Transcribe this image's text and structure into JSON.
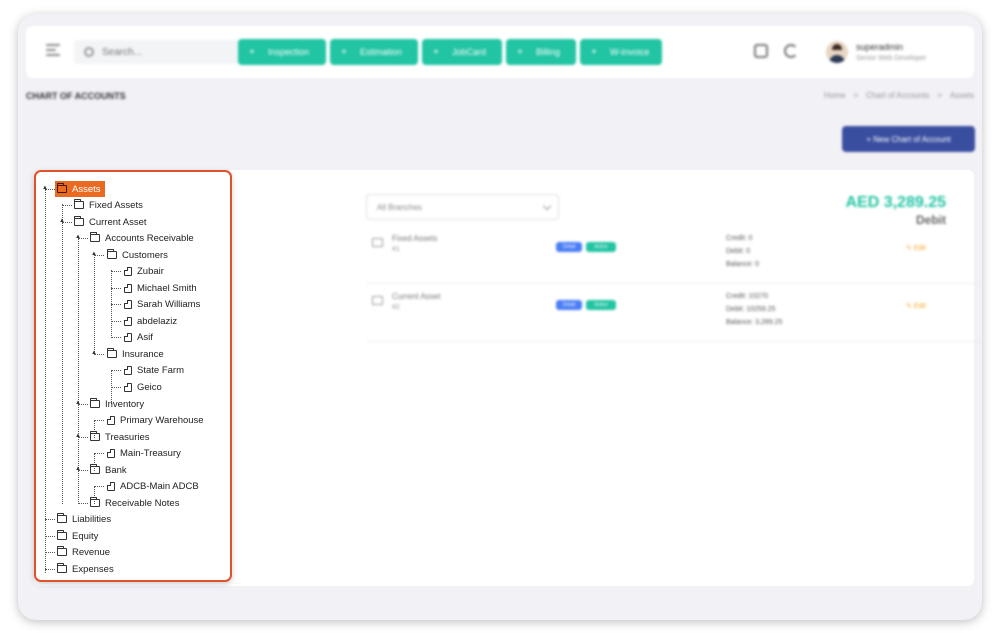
{
  "topbar": {
    "search_placeholder": "Search...",
    "quick_actions": [
      {
        "label": "Inspection"
      },
      {
        "label": "Estimation"
      },
      {
        "label": "JobCard"
      },
      {
        "label": "Billing"
      },
      {
        "label": "W-invoice"
      }
    ],
    "user": {
      "name": "superadmin",
      "role": "Senior Web Developer"
    }
  },
  "page": {
    "title": "CHART OF ACCOUNTS",
    "breadcrumbs": [
      "Home",
      ">",
      "Chart of Accounts",
      ">",
      "Assets"
    ],
    "new_button": "+ New Chart of Account"
  },
  "tree": {
    "assets": "Assets",
    "fixed_assets": "Fixed Assets",
    "current_asset": "Current Asset",
    "accounts_receivable": "Accounts Receivable",
    "customers": "Customers",
    "zubair": "Zubair",
    "michael": "Michael Smith",
    "sarah": "Sarah Williams",
    "abdelaziz": "abdelaziz",
    "asif": "Asif",
    "insurance": "Insurance",
    "state_farm": "State Farm",
    "geico": "Geico",
    "inventory": "Inventory",
    "primary_warehouse": "Primary Warehouse",
    "treasuries": "Treasuries",
    "main_treasury": "Main-Treasury",
    "bank": "Bank",
    "adcb": "ADCB-Main ADCB",
    "receivable_notes": "Receivable Notes",
    "liabilities": "Liabilities",
    "equity": "Equity",
    "revenue": "Revenue",
    "expenses": "Expenses"
  },
  "detail": {
    "branch_select": "All Branches",
    "amount": "AED 3,289.25",
    "amount_type": "Debit",
    "rows": [
      {
        "name": "Fixed Assets",
        "code": "#1",
        "badge1": "Detail",
        "badge2": "Active",
        "credit": "Credit: 0",
        "debit": "Debit: 0",
        "balance": "Balance: 0",
        "edit": "✎ Edit"
      },
      {
        "name": "Current Asset",
        "code": "#2",
        "badge1": "Detail",
        "badge2": "Active",
        "credit": "Credit: 10270",
        "debit": "Debit: 10259.25",
        "balance": "Balance: 3,289.25",
        "edit": "✎ Edit"
      }
    ]
  },
  "colors": {
    "accent": "#21c4a3",
    "selected": "#ea6a21",
    "primary_button": "#3a4ea0",
    "highlight_border": "#e0522b"
  }
}
